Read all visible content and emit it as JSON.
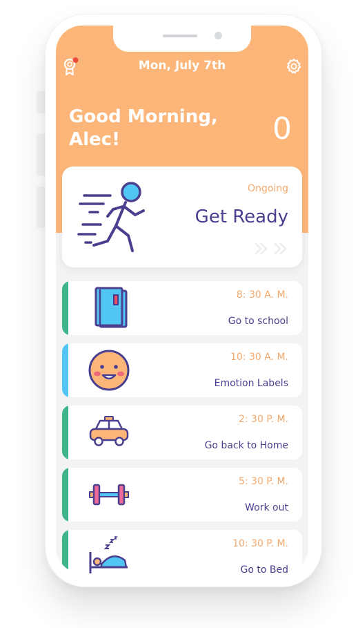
{
  "header": {
    "date": "Mon, July 7th",
    "greeting_line1": "Good Morning,",
    "greeting_line2": "Alec!",
    "score": "0"
  },
  "current_task": {
    "status": "Ongoing",
    "title": "Get Ready"
  },
  "tasks": [
    {
      "time": "8: 30 A. M.",
      "name": "Go to school",
      "icon": "book-icon",
      "bar_color": "#3eb489"
    },
    {
      "time": "10: 30 A. M.",
      "name": "Emotion Labels",
      "icon": "smiley-face-icon",
      "bar_color": "#52c6f3"
    },
    {
      "time": "2: 30 P. M.",
      "name": "Go back to Home",
      "icon": "taxi-icon",
      "bar_color": "#3eb489"
    },
    {
      "time": "5: 30 P. M.",
      "name": "Work out",
      "icon": "dumbbell-icon",
      "bar_color": "#3eb489"
    },
    {
      "time": "10: 30 P. M.",
      "name": "Go to Bed",
      "icon": "sleeping-icon",
      "bar_color": "#3eb489"
    }
  ],
  "colors": {
    "header_bg": "#fdb679",
    "accent_text": "#f5a96c",
    "primary_text": "#4a3f8f",
    "notification_dot": "#ee4b3e"
  }
}
